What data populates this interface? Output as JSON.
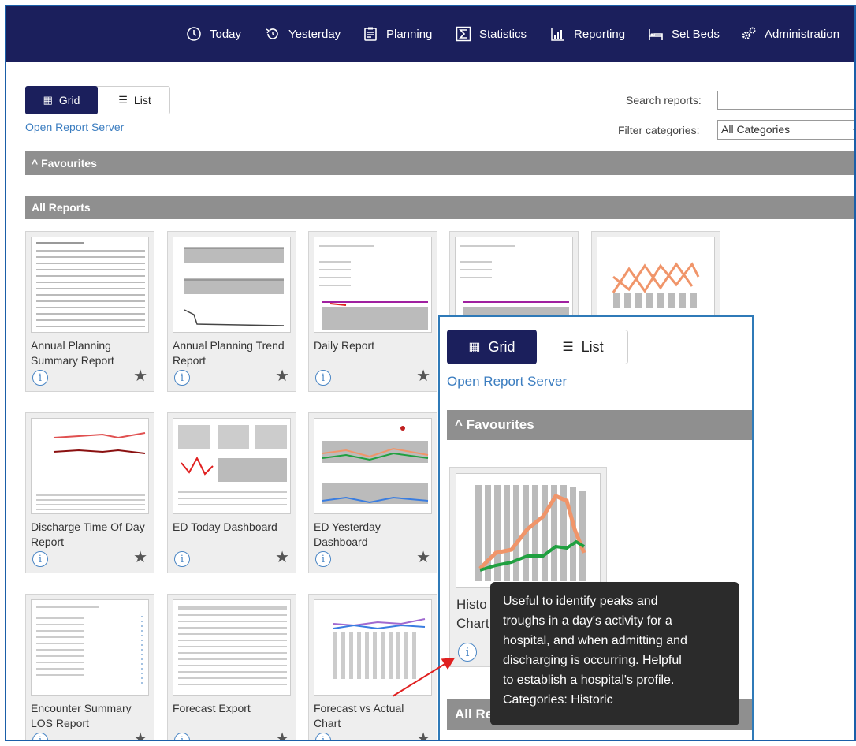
{
  "nav": {
    "items": [
      {
        "label": "Today",
        "icon": "clock-icon"
      },
      {
        "label": "Yesterday",
        "icon": "history-icon"
      },
      {
        "label": "Planning",
        "icon": "clipboard-icon"
      },
      {
        "label": "Statistics",
        "icon": "sigma-icon"
      },
      {
        "label": "Reporting",
        "icon": "bar-chart-icon"
      },
      {
        "label": "Set Beds",
        "icon": "bed-icon"
      },
      {
        "label": "Administration",
        "icon": "gears-icon"
      }
    ]
  },
  "view_toggle": {
    "grid_label": "Grid",
    "list_label": "List",
    "selected": "Grid"
  },
  "open_report_server": "Open Report Server",
  "search": {
    "label": "Search reports:",
    "value": ""
  },
  "filter": {
    "label": "Filter categories:",
    "selected": "All Categories"
  },
  "sections": {
    "favourites": "Favourites",
    "all_reports": "All Reports"
  },
  "reports": [
    {
      "title": "Annual Planning Summary Report"
    },
    {
      "title": "Annual Planning Trend Report"
    },
    {
      "title": "Daily Report"
    },
    {
      "title": ""
    },
    {
      "title": ""
    },
    {
      "title": "Discharge Time Of Day Report"
    },
    {
      "title": "ED Today Dashboard"
    },
    {
      "title": "ED Yesterday Dashboard"
    },
    {
      "title": "Encounter Summary LOS Report"
    },
    {
      "title": "Forecast Export"
    },
    {
      "title": "Forecast vs Actual Chart"
    }
  ],
  "zoom": {
    "grid_label": "Grid",
    "list_label": "List",
    "open_report_server": "Open Report Server",
    "favourites": "Favourites",
    "fav_card_title_line1": "Histo",
    "fav_card_title_line2": "Chart",
    "all_reports_partial": "All Re",
    "tooltip_lines": [
      "Useful to identify peaks and",
      "troughs in a day's activity for a",
      "hospital, and when admitting and",
      "discharging is occurring. Helpful",
      "to establish a hospital's profile.",
      "Categories: Historic"
    ]
  },
  "colors": {
    "nav_bg": "#1b1f5c",
    "section_bar": "#8f8f8f",
    "link": "#3b7dc0",
    "highlight_border": "#2f7ab8",
    "arrow": "#e02020"
  }
}
